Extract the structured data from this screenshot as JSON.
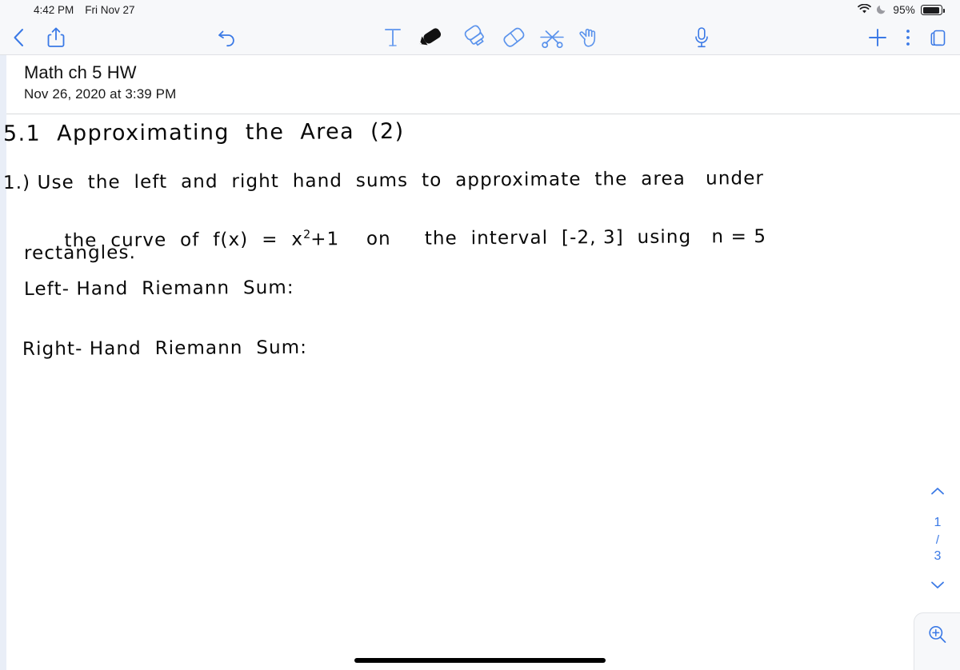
{
  "status_bar": {
    "time": "4:42 PM",
    "date": "Fri Nov 27",
    "battery_percent": "95%",
    "icons": [
      "wifi-icon",
      "do-not-disturb-moon-icon",
      "battery-icon"
    ]
  },
  "toolbar": {
    "back_label": "Back",
    "share_label": "Share",
    "undo_label": "Undo",
    "tools": [
      {
        "name": "text-tool",
        "label": "Text",
        "selected": false
      },
      {
        "name": "pen-tool",
        "label": "Pen",
        "selected": true
      },
      {
        "name": "highlighter-tool",
        "label": "Highlighter",
        "selected": false
      },
      {
        "name": "eraser-tool",
        "label": "Eraser",
        "selected": false
      },
      {
        "name": "scissors-tool",
        "label": "Cut",
        "selected": false
      },
      {
        "name": "hand-tool",
        "label": "Hand",
        "selected": false
      }
    ],
    "microphone_label": "Record audio",
    "add_label": "Add",
    "more_label": "More",
    "pages_label": "Pages"
  },
  "document": {
    "title": "Math ch 5 HW",
    "date": "Nov 26, 2020 at 3:39 PM"
  },
  "notes": {
    "heading": "5.1  Approximating  the  Area  (2)",
    "line1": "1.) Use  the  left  and  right  hand  sums  to  approximate  the  area   under",
    "line2_a": "the  curve  of  f(x)  =  x",
    "line2_sup": "2",
    "line2_b": "+1    on     the  interval  [-2, 3]  using   n = 5",
    "line3": "rectangles.",
    "left_sum_label": "Left- Hand  Riemann  Sum:",
    "right_sum_label": "Right- Hand  Riemann  Sum:"
  },
  "page_nav": {
    "prev_label": "Previous page",
    "current_page": "1",
    "separator": "/",
    "total_pages": "3",
    "next_label": "Next page"
  },
  "zoom_control": {
    "label": "Zoom in"
  },
  "colors": {
    "accent": "#3a79e6",
    "chrome_bg": "#f7f8fa",
    "ink": "#090909",
    "divider": "#d8dadd",
    "margin_strip": "#e9eef7"
  }
}
